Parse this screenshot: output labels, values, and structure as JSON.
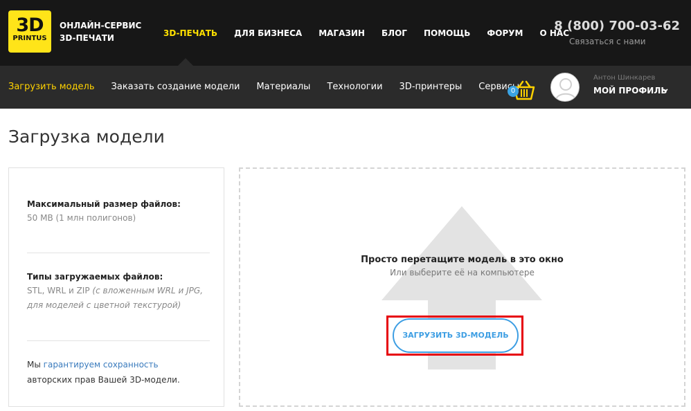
{
  "logo": {
    "line1": "3D",
    "line2": "PRINTUS"
  },
  "service": {
    "line1": "ОНЛАЙН-СЕРВИС",
    "line2": "3D-ПЕЧАТИ"
  },
  "main_nav": [
    {
      "label": "3D-ПЕЧАТЬ",
      "active": true
    },
    {
      "label": "ДЛЯ БИЗНЕСА"
    },
    {
      "label": "МАГАЗИН"
    },
    {
      "label": "БЛОГ"
    },
    {
      "label": "ПОМОЩЬ"
    },
    {
      "label": "ФОРУМ"
    },
    {
      "label": "О НАС"
    }
  ],
  "phone": "8 (800) 700-03-62",
  "contact_label": "Связаться с нами",
  "sub_nav": [
    {
      "label": "Загрузить модель",
      "active": true
    },
    {
      "label": "Заказать создание модели"
    },
    {
      "label": "Материалы"
    },
    {
      "label": "Технологии"
    },
    {
      "label": "3D-принтеры"
    },
    {
      "label": "Сервисы"
    }
  ],
  "cart": {
    "count": "0"
  },
  "user": {
    "name": "Антон Шинкарев",
    "profile_label": "МОЙ ПРОФИЛЬ"
  },
  "page_title": "Загрузка модели",
  "info": {
    "max_size_heading": "Максимальный размер файлов:",
    "max_size_value": "50 MB (1 млн полигонов)",
    "types_heading": "Типы загружаемых файлов:",
    "types_value": "STL, WRL и ZIP",
    "types_note": "(с вложенным WRL и JPG, для моделей с цветной текстурой)",
    "guarantee_prefix": "Мы",
    "guarantee_link": "гарантируем сохранность",
    "guarantee_suffix": "авторских прав Вашей 3D-модели."
  },
  "dropzone": {
    "main_text": "Просто перетащите модель в это окно",
    "sub_text": "Или выберите её на компьютере",
    "upload_button": "ЗАГРУЗИТЬ 3D-МОДЕЛЬ"
  },
  "colors": {
    "accent": "#ffe000",
    "link": "#3a7bbd",
    "button": "#3d9ee3",
    "highlight": "#e6000a"
  }
}
